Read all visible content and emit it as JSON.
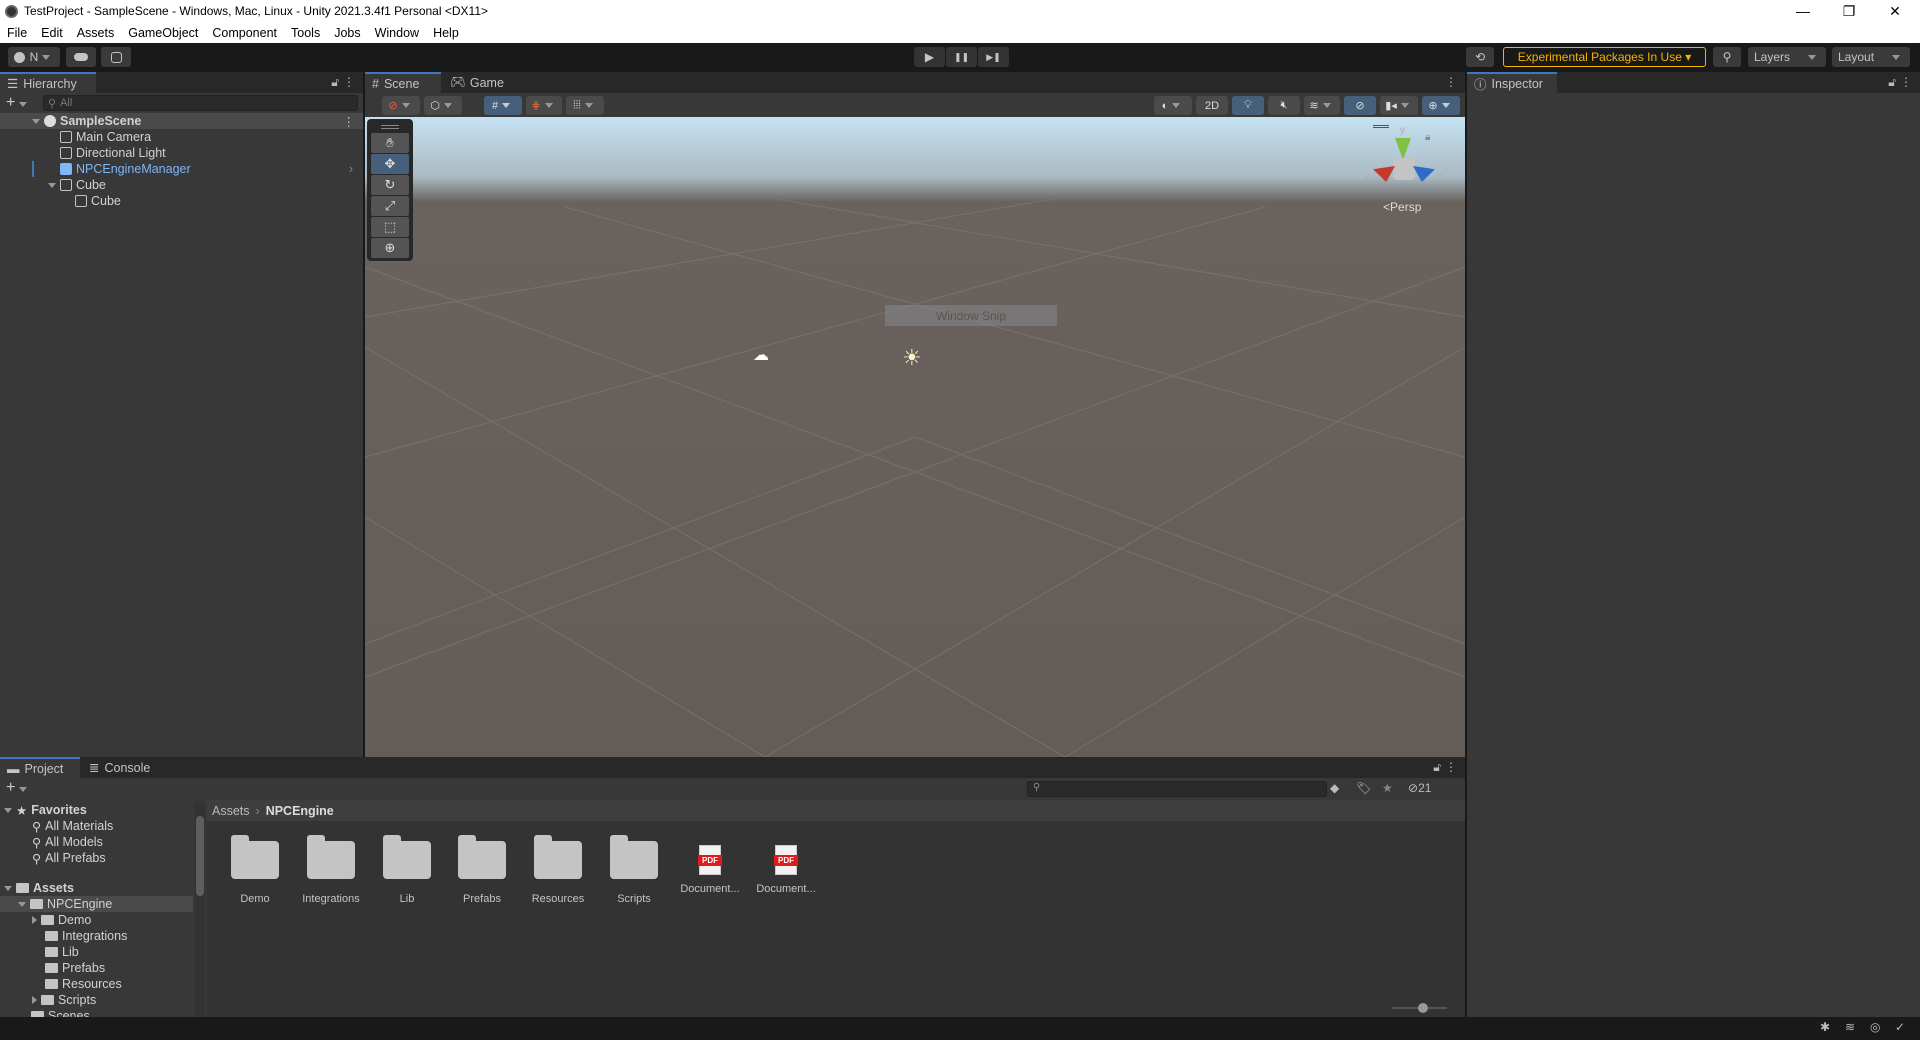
{
  "window": {
    "title": "TestProject - SampleScene - Windows, Mac, Linux - Unity 2021.3.4f1 Personal <DX11>",
    "controls": {
      "minimize": "—",
      "restore": "❐",
      "close": "✕"
    }
  },
  "menu": [
    "File",
    "Edit",
    "Assets",
    "GameObject",
    "Component",
    "Tools",
    "Jobs",
    "Window",
    "Help"
  ],
  "toolbar": {
    "account_label": "N",
    "play_icon": "▶",
    "pause_icon": "❚❚",
    "step_icon": "▶❚",
    "experimental_label": "Experimental Packages In Use ▾",
    "layers_label": "Layers",
    "layout_label": "Layout",
    "accent_color": "#f4b400"
  },
  "hierarchy": {
    "tab_label": "Hierarchy",
    "search_placeholder": "All",
    "scene_name": "SampleScene",
    "items": [
      {
        "label": "Main Camera",
        "depth": 1
      },
      {
        "label": "Directional Light",
        "depth": 1
      },
      {
        "label": "NPCEngineManager",
        "depth": 1,
        "prefab": true
      },
      {
        "label": "Cube",
        "depth": 1,
        "expanded": true
      },
      {
        "label": "Cube",
        "depth": 2
      }
    ],
    "prefab_color": "#7fb6f5"
  },
  "scene": {
    "tabs": [
      "Scene",
      "Game"
    ],
    "toolbar": {
      "two_d": "2D"
    },
    "view_mode": "Persp",
    "gizmo_axes": {
      "x": "x",
      "y": "y",
      "z": "z"
    },
    "overlay_text": "Window Snip"
  },
  "inspector": {
    "tab_label": "Inspector"
  },
  "project": {
    "tabs": [
      "Project",
      "Console"
    ],
    "favorites": {
      "label": "Favorites",
      "items": [
        "All Materials",
        "All Models",
        "All Prefabs"
      ]
    },
    "assets": {
      "label": "Assets",
      "tree": [
        {
          "label": "NPCEngine",
          "depth": 1,
          "expanded": true
        },
        {
          "label": "Demo",
          "depth": 2,
          "has_children": true
        },
        {
          "label": "Integrations",
          "depth": 2
        },
        {
          "label": "Lib",
          "depth": 2
        },
        {
          "label": "Prefabs",
          "depth": 2
        },
        {
          "label": "Resources",
          "depth": 2
        },
        {
          "label": "Scripts",
          "depth": 2,
          "has_children": true
        },
        {
          "label": "Scenes",
          "depth": 1
        }
      ]
    },
    "breadcrumb": [
      "Assets",
      "NPCEngine"
    ],
    "hidden_count": "21",
    "grid_items": [
      {
        "label": "Demo",
        "type": "folder"
      },
      {
        "label": "Integrations",
        "type": "folder"
      },
      {
        "label": "Lib",
        "type": "folder"
      },
      {
        "label": "Prefabs",
        "type": "folder"
      },
      {
        "label": "Resources",
        "type": "folder"
      },
      {
        "label": "Scripts",
        "type": "folder"
      },
      {
        "label": "Document...",
        "type": "pdf"
      },
      {
        "label": "Document...",
        "type": "pdf"
      }
    ],
    "pdf_badge": "PDF",
    "zoom_slider_value": 0.55
  }
}
